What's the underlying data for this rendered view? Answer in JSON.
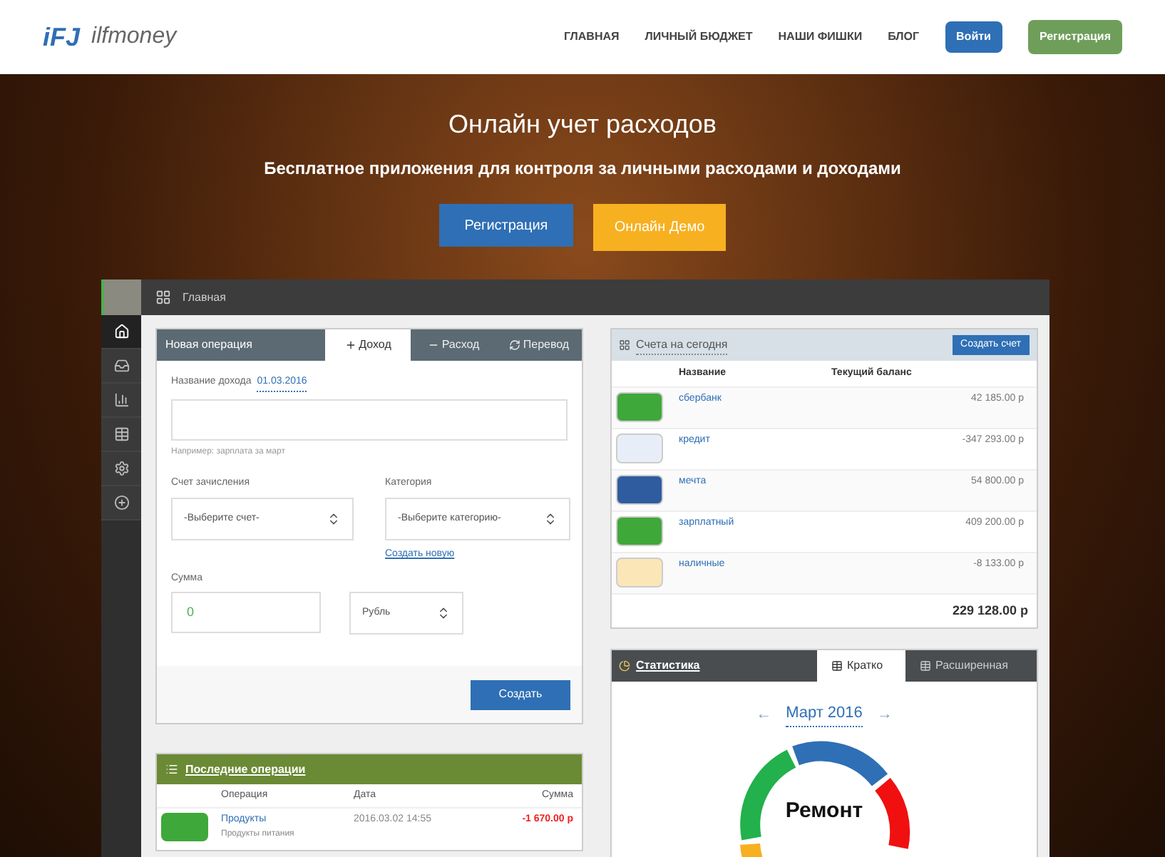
{
  "header": {
    "logo_mark": "iFJ",
    "logo_text": "ilfmoney",
    "nav": [
      "ГЛАВНАЯ",
      "ЛИЧНЫЙ БЮДЖЕТ",
      "НАШИ ФИШКИ",
      "БЛОГ"
    ],
    "login": "Войти",
    "register": "Регистрация"
  },
  "hero": {
    "title": "Онлайн учет расходов",
    "subtitle": "Бесплатное приложения для контроля за личными расходами и доходами",
    "buttons": [
      {
        "label": "Регистрация",
        "kind": "primary"
      },
      {
        "label": "Онлайн Демо",
        "kind": "demo"
      }
    ]
  },
  "app": {
    "top_title": "Главная",
    "sidebar": [
      {
        "kind": "home",
        "selected": true
      },
      {
        "kind": "inbox",
        "selected": false
      },
      {
        "kind": "chart",
        "selected": false
      },
      {
        "kind": "table",
        "selected": false
      },
      {
        "kind": "gear",
        "selected": false
      },
      {
        "kind": "plus",
        "selected": false
      }
    ],
    "operation": {
      "title": "Новая операция",
      "tabs": [
        {
          "label": "Доход",
          "kind": "plus",
          "selected": true
        },
        {
          "label": "Расход",
          "kind": "minus",
          "selected": false
        },
        {
          "label": "Перевод",
          "kind": "transfer",
          "selected": false
        }
      ],
      "name_label": "Название дохода",
      "date": "01.03.2016",
      "hint": "Например: зарплата за март",
      "account_label": "Счет зачисления",
      "account_select": "-Выберите счет-",
      "category_label": "Категория",
      "category_select": "-Выберите категорию-",
      "create_new": "Создать новую",
      "sum_label": "Сумма",
      "sum_value": "0",
      "currency": "Рубль",
      "submit": "Создать"
    },
    "recent": {
      "title": "Последние операции",
      "columns": [
        "Операция",
        "Дата",
        "Сумма"
      ],
      "rows": [
        {
          "name": "Продукты",
          "note": "Продукты питания",
          "date": "2016.03.02 14:55",
          "amount": "-1 670.00 р",
          "color": "#3fa83a"
        }
      ]
    },
    "accounts": {
      "title": "Счета на сегодня",
      "create": "Создать счет",
      "columns": [
        "Название",
        "Текущий баланс"
      ],
      "rows": [
        {
          "name": "сбербанк",
          "balance": "42 185.00 р",
          "color": "#3fa83a"
        },
        {
          "name": "кредит",
          "balance": "-347 293.00 р",
          "color": "#e8eef8"
        },
        {
          "name": "мечта",
          "balance": "54 800.00 р",
          "color": "#2f5c9e"
        },
        {
          "name": "зарплатный",
          "balance": "409 200.00 р",
          "color": "#3fa83a"
        },
        {
          "name": "наличные",
          "balance": "-8 133.00 р",
          "color": "#fbe6b8"
        }
      ],
      "total": "229 128.00 р"
    },
    "stats": {
      "title": "Статистика",
      "tabs": [
        {
          "label": "Кратко",
          "selected": true
        },
        {
          "label": "Расширенная",
          "selected": false
        }
      ],
      "prev": "←",
      "month": "Март 2016",
      "next": "→",
      "center_label": "Ремонт"
    }
  }
}
